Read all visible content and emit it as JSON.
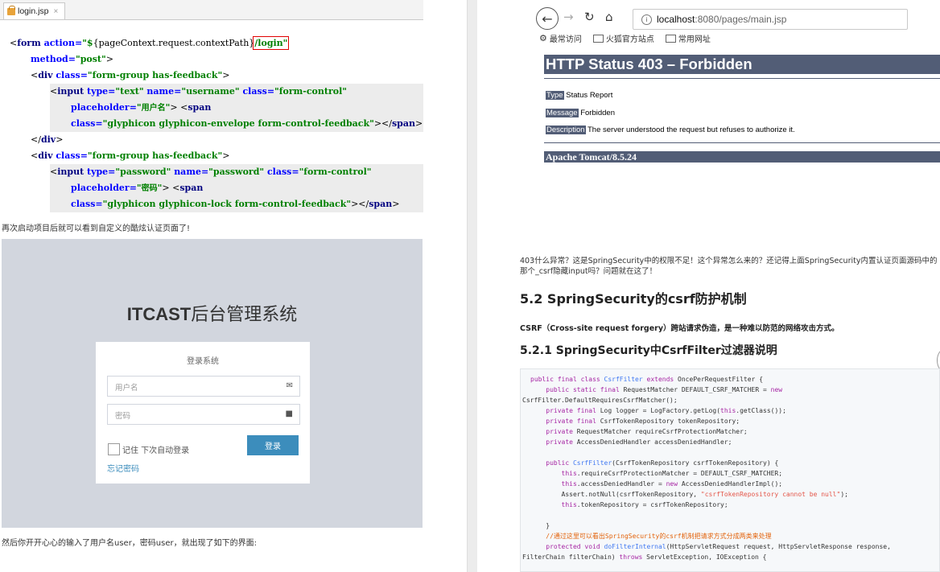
{
  "editor": {
    "tab_label": "login.jsp",
    "tab_close": "×",
    "line1": {
      "open": "<",
      "tag": "form",
      "attr": " action=",
      "val_a": "\"$",
      "brace": "{",
      "expr": "pageContext.request.contextPath",
      "close_brace": "}",
      "boxed": "/login\""
    },
    "line2": {
      "attr": "method=",
      "val": "\"post\"",
      "close": ">"
    },
    "line3": {
      "open": "<",
      "tag": "div",
      "attr": " class=",
      "val": "\"form-group has-feedback\"",
      "close": ">"
    },
    "line4": {
      "open": "<",
      "tag": "input",
      "attr1": " type=",
      "val1": "\"text\"",
      "attr2": " name=",
      "val2": "\"username\"",
      "attr3": " class=",
      "val3": "\"form-control\""
    },
    "line5": {
      "attr": "placeholder=",
      "val_open": "\"",
      "val_cjk": "用户名",
      "val_close": "\"",
      "close": ">",
      "open2": " <",
      "tag2": "span"
    },
    "line6": {
      "attr": "class=",
      "val": "\"glyphicon glyphicon-envelope form-control-feedback\"",
      "close": "></",
      "tag": "span",
      "end": ">"
    },
    "line7": {
      "open": "</",
      "tag": "div",
      "close": ">"
    },
    "line8": {
      "open": "<",
      "tag": "div",
      "attr": " class=",
      "val": "\"form-group has-feedback\"",
      "close": ">"
    },
    "line9": {
      "open": "<",
      "tag": "input",
      "attr1": " type=",
      "val1": "\"password\"",
      "attr2": " name=",
      "val2": "\"password\"",
      "attr3": " class=",
      "val3": "\"form-control\""
    },
    "line10": {
      "attr": "placeholder=",
      "val_open": "\"",
      "val_cjk": "密码",
      "val_close": "\"",
      "close": ">",
      "open2": " <",
      "tag2": "span"
    },
    "line11": {
      "attr": "class=",
      "val": "\"glyphicon glyphicon-lock form-control-feedback\"",
      "close": "></",
      "tag": "span",
      "end": ">"
    }
  },
  "left_text": {
    "restart": "再次启动项目后就可以看到自定义的酷炫认证页面了!",
    "after_login": "然后你开开心心的输入了用户名user，密码user，就出现了如下的界面:"
  },
  "login": {
    "brand_bold": "ITCAST",
    "brand_rest": "后台管理系统",
    "title": "登录系统",
    "username_placeholder": "用户名",
    "password_placeholder": "密码",
    "remember": "记住 下次自动登录",
    "submit": "登录",
    "forgot": "忘记密码"
  },
  "browser": {
    "url_host": "localhost",
    "url_rest": ":8080/pages/main.jsp",
    "bookmarks": [
      "最常访问",
      "火狐官方站点",
      "常用网址"
    ]
  },
  "error_page": {
    "title": "HTTP Status 403 – Forbidden",
    "type_label": "Type",
    "type_value": " Status Report",
    "message_label": "Message",
    "message_value": " Forbidden",
    "desc_label": "Description",
    "desc_value": " The server understood the request but refuses to authorize it.",
    "server": "Apache Tomcat/8.5.24"
  },
  "article": {
    "para": "403什么异常？这是SpringSecurity中的权限不足！这个异常怎么来的？还记得上面SpringSecurity内置认证页面源码中的那个_csrf隐藏input吗？问题就在这了！",
    "h52": "5.2 SpringSecurity的csrf防护机制",
    "csrf_desc": "CSRF（Cross-site request forgery）跨站请求伪造，是一种难以防范的网络攻击方式。",
    "h521": "5.2.1 SpringSecurity中CsrfFilter过滤器说明",
    "code": {
      "l1a": "public final class ",
      "l1b": "CsrfFilter",
      "l1c": " extends ",
      "l1d": "OncePerRequestFilter {",
      "l2a": "    public static final ",
      "l2b": "RequestMatcher DEFAULT_CSRF_MATCHER = ",
      "l2c": "new",
      "l3": "CsrfFilter.DefaultRequiresCsrfMatcher();",
      "l4a": "    private final ",
      "l4b": "Log logger = LogFactory.getLog(",
      "l4c": "this",
      "l4d": ".getClass());",
      "l5a": "    private final ",
      "l5b": "CsrfTokenRepository tokenRepository;",
      "l6a": "    private ",
      "l6b": "RequestMatcher requireCsrfProtectionMatcher;",
      "l7a": "    private ",
      "l7b": "AccessDeniedHandler accessDeniedHandler;",
      "l8a": "    public ",
      "l8b": "CsrfFilter",
      "l8c": "(CsrfTokenRepository csrfTokenRepository) {",
      "l9a": "        this",
      "l9b": ".requireCsrfProtectionMatcher = DEFAULT_CSRF_MATCHER;",
      "l10a": "        this",
      "l10b": ".accessDeniedHandler = ",
      "l10c": "new",
      "l10d": " AccessDeniedHandlerImpl();",
      "l11a": "        Assert.notNull(csrfTokenRepository, ",
      "l11b": "\"csrfTokenRepository cannot be null\"",
      "l11c": ");",
      "l12a": "        this",
      "l12b": ".tokenRepository = csrfTokenRepository;",
      "l13": "    }",
      "l14": "    //通过这里可以看出SpringSecurity的csrf机制把请求方式分成两类来处理",
      "l15a": "    protected void ",
      "l15b": "doFilterInternal",
      "l15c": "(HttpServletRequest request, HttpServletResponse response,",
      "l16a": "FilterChain filterChain) ",
      "l16b": "throws",
      "l16c": " ServletException, IOException {"
    }
  },
  "colors": {
    "tomcat_bar": "#525d76",
    "login_button": "#3c8dbc",
    "login_bg": "#d2d6de"
  }
}
